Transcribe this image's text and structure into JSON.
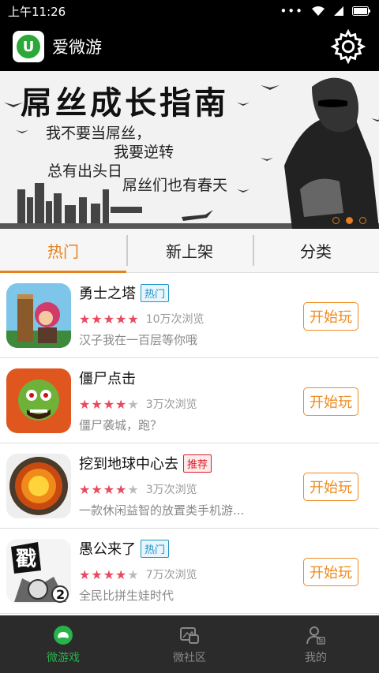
{
  "status": {
    "time": "上午11:26"
  },
  "app": {
    "title": "爱微游",
    "logo_letter": "U"
  },
  "banner": {
    "title": "屌丝成长指南",
    "lines": [
      "我不要当屌丝，",
      "我要逆转",
      "总有出头日",
      "屌丝们也有春天"
    ],
    "dots": 3,
    "active_dot": 1
  },
  "tabs": [
    {
      "label": "热门",
      "active": true
    },
    {
      "label": "新上架",
      "active": false
    },
    {
      "label": "分类",
      "active": false
    }
  ],
  "games": [
    {
      "name": "勇士之塔",
      "badge": "热门",
      "badge_type": "hot",
      "rating": 5,
      "views": "10万次浏览",
      "desc": "汉子我在一百层等你哦",
      "button": "开始玩",
      "icon": "tower-warrior-icon"
    },
    {
      "name": "僵尸点击",
      "badge": "",
      "badge_type": "",
      "rating": 4,
      "views": "3万次浏览",
      "desc": "僵尸袭城，跑？",
      "button": "开始玩",
      "icon": "zombie-icon"
    },
    {
      "name": "挖到地球中心去",
      "badge": "推荐",
      "badge_type": "rec",
      "rating": 4,
      "views": "3万次浏览",
      "desc": "一款休闲益智的放置类手机游...",
      "button": "开始玩",
      "icon": "earth-core-icon"
    },
    {
      "name": "愚公来了",
      "badge": "热门",
      "badge_type": "hot",
      "rating": 4,
      "views": "7万次浏览",
      "desc": "全民比拼生娃时代",
      "button": "开始玩",
      "icon": "yugong-icon"
    }
  ],
  "nav": [
    {
      "label": "微游戏",
      "active": true,
      "icon": "gamepad-icon"
    },
    {
      "label": "微社区",
      "active": false,
      "icon": "community-icon"
    },
    {
      "label": "我的",
      "active": false,
      "icon": "profile-icon"
    }
  ],
  "colors": {
    "accent": "#e8811a",
    "nav_active": "#27b24a",
    "star": "#e84a5f"
  }
}
